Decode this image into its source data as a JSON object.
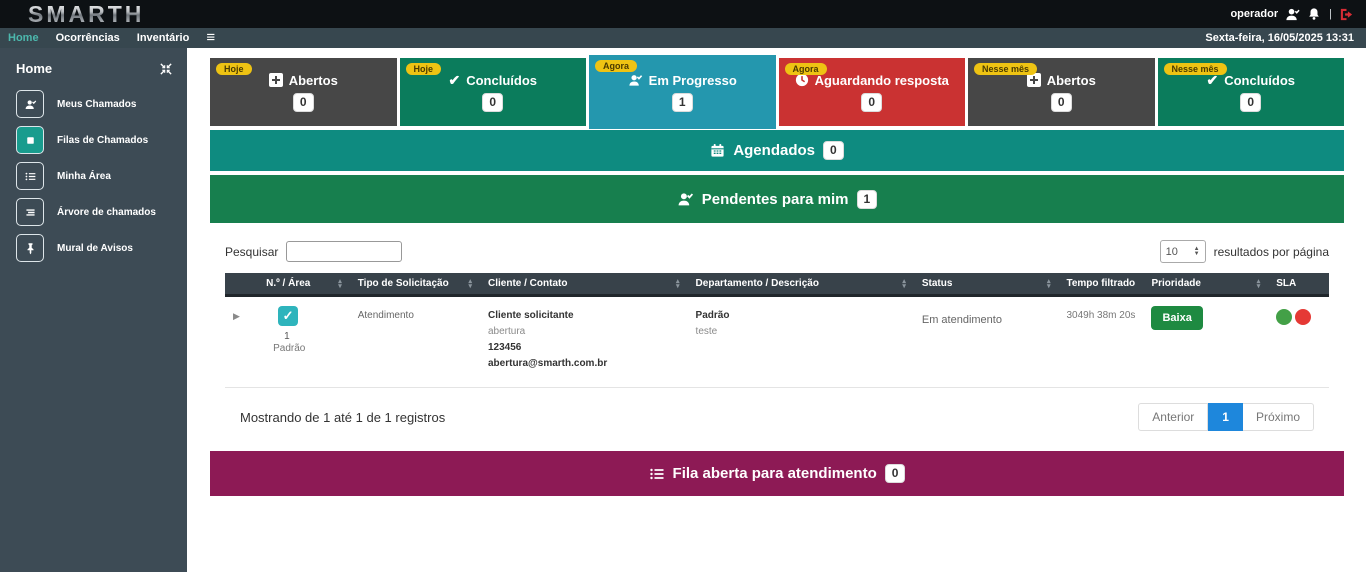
{
  "topbar": {
    "logo": "SMARTH",
    "user": "operador",
    "separator": "|"
  },
  "navbar": {
    "items": [
      {
        "label": "Home",
        "active": true
      },
      {
        "label": "Ocorrências",
        "active": false
      },
      {
        "label": "Inventário",
        "active": false
      }
    ],
    "datetime": "Sexta-feira, 16/05/2025 13:31"
  },
  "sidebar": {
    "title": "Home",
    "items": [
      {
        "label": "Meus Chamados",
        "icon": "user-check-icon",
        "active": false
      },
      {
        "label": "Filas de Chamados",
        "icon": "square-icon",
        "active": true
      },
      {
        "label": "Minha Área",
        "icon": "list-icon",
        "active": false
      },
      {
        "label": "Árvore de chamados",
        "icon": "tree-icon",
        "active": false
      },
      {
        "label": "Mural de Avisos",
        "icon": "pin-icon",
        "active": false
      }
    ]
  },
  "cards": [
    {
      "badge": "Hoje",
      "label": "Abertos",
      "count": "0",
      "color": "#474747",
      "icon": "plus-square-icon"
    },
    {
      "badge": "Hoje",
      "label": "Concluídos",
      "count": "0",
      "color": "#0b7c5c",
      "icon": "check-icon",
      "check": "✔"
    },
    {
      "badge": "Agora",
      "label": "Em Progresso",
      "count": "1",
      "color": "#2497ae",
      "icon": "user-check-icon"
    },
    {
      "badge": "Agora",
      "label": "Aguardando resposta",
      "count": "0",
      "color": "#ca3232",
      "icon": "clock-icon"
    },
    {
      "badge": "Nesse mês",
      "label": "Abertos",
      "count": "0",
      "color": "#474747",
      "icon": "plus-square-icon"
    },
    {
      "badge": "Nesse mês",
      "label": "Concluídos",
      "count": "0",
      "color": "#0b7c5c",
      "icon": "check-icon",
      "check": "✔"
    }
  ],
  "banners": {
    "agendados": {
      "label": "Agendados",
      "count": "0",
      "color": "#0e8b80",
      "icon": "calendar-icon"
    },
    "pendentes": {
      "label": "Pendentes para mim",
      "count": "1",
      "color": "#177f4e",
      "icon": "user-check-icon"
    },
    "fila": {
      "label": "Fila aberta para atendimento",
      "count": "0",
      "color": "#8d1a55",
      "icon": "list-icon"
    }
  },
  "table": {
    "search_label": "Pesquisar",
    "page_size": "10",
    "page_size_suffix": "resultados por página",
    "columns": [
      {
        "label": "N.º / Área",
        "sortable": true
      },
      {
        "label": "Tipo de Solicitação",
        "sortable": true
      },
      {
        "label": "Cliente / Contato",
        "sortable": true
      },
      {
        "label": "Departamento / Descrição",
        "sortable": true
      },
      {
        "label": "Status",
        "sortable": true
      },
      {
        "label": "Tempo filtrado",
        "sortable": false
      },
      {
        "label": "Prioridade",
        "sortable": true
      },
      {
        "label": "SLA",
        "sortable": false
      }
    ],
    "row": {
      "expander": "▶",
      "check": "✓",
      "number": "1",
      "area": "Padrão",
      "tipo": "Atendimento",
      "cliente": "Cliente solicitante",
      "contato_usuario": "abertura",
      "contato_numero": "123456",
      "contato_email": "abertura@smarth.com.br",
      "departamento": "Padrão",
      "descricao": "teste",
      "status": "Em atendimento",
      "tempo": "3049h 38m 20s",
      "prioridade": "Baixa"
    },
    "footer": "Mostrando de 1 até 1 de 1 registros",
    "pagination": {
      "prev": "Anterior",
      "page": "1",
      "next": "Próximo"
    }
  }
}
